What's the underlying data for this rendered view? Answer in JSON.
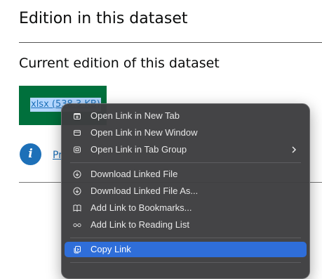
{
  "page": {
    "heading": "Edition in this dataset",
    "current_heading": "Current edition of this dataset",
    "download_link": "xlsx (538.3 KB)",
    "info_link_partial": "Pr"
  },
  "context_menu": {
    "items": [
      {
        "label": "Open Link in New Tab",
        "icon": "new-tab-icon"
      },
      {
        "label": "Open Link in New Window",
        "icon": "new-window-icon"
      },
      {
        "label": "Open Link in Tab Group",
        "icon": "tab-group-icon",
        "submenu": true
      },
      {
        "label": "Download Linked File",
        "icon": "download-icon"
      },
      {
        "label": "Download Linked File As...",
        "icon": "download-as-icon"
      },
      {
        "label": "Add Link to Bookmarks...",
        "icon": "bookmarks-icon"
      },
      {
        "label": "Add Link to Reading List",
        "icon": "reading-list-icon"
      },
      {
        "label": "Copy Link",
        "icon": "copy-link-icon",
        "active": true
      }
    ]
  },
  "colors": {
    "download_box": "#00703c",
    "link": "#1d70b8",
    "menu_bg": "#3e3e40",
    "menu_highlight": "#2f6ed9"
  }
}
